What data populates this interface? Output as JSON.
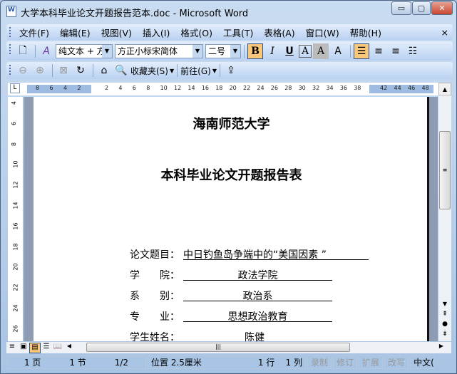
{
  "window": {
    "title": "大学本科毕业论文开题报告范本.doc - Microsoft Word",
    "app_icon": "W",
    "minimize": "▭",
    "maximize": "▢",
    "close": "✕"
  },
  "menu": [
    "文件(F)",
    "编辑(E)",
    "视图(V)",
    "插入(I)",
    "格式(O)",
    "工具(T)",
    "表格(A)",
    "窗口(W)",
    "帮助(H)"
  ],
  "menu_close": "×",
  "format_toolbar": {
    "style": "纯文本 + 方",
    "font": "方正小标宋简体",
    "size": "二号",
    "bold": "B",
    "italic": "I",
    "underline": "U",
    "char_border": "A",
    "char_shading": "A",
    "scale": "A"
  },
  "web_toolbar": {
    "favorites": "收藏夹(S)",
    "go": "前往(G)"
  },
  "ruler": {
    "left": [
      "8",
      "6",
      "4",
      "2"
    ],
    "main": [
      "2",
      "4",
      "6",
      "8",
      "10",
      "12",
      "14",
      "16",
      "18",
      "20",
      "22",
      "24",
      "26",
      "28",
      "30",
      "32",
      "34",
      "36",
      "38"
    ],
    "right": [
      "42",
      "44",
      "46",
      "48"
    ],
    "vertical": [
      "4",
      "6",
      "8",
      "10",
      "12",
      "14",
      "16",
      "18",
      "20",
      "22",
      "24",
      "26"
    ]
  },
  "document": {
    "university": "海南师范大学",
    "form_title": "本科毕业论文开题报告表",
    "fields": [
      {
        "label": "论文题目：",
        "value": "中日钓鱼岛争端中的“美国因素 ”"
      },
      {
        "label": "学　　院：",
        "value": "政法学院"
      },
      {
        "label": "系　　别：",
        "value": "政治系"
      },
      {
        "label": "专　　业：",
        "value": "思想政治教育"
      },
      {
        "label": "学生姓名：",
        "value": "陈健"
      }
    ]
  },
  "status": {
    "page": "1 页",
    "section": "1 节",
    "pages": "1/2",
    "position": "位置 2.5厘米",
    "line": "1 行",
    "column": "1 列",
    "rec": "录制",
    "trk": "修订",
    "ext": "扩展",
    "ovr": "改写",
    "lang": "中文("
  }
}
